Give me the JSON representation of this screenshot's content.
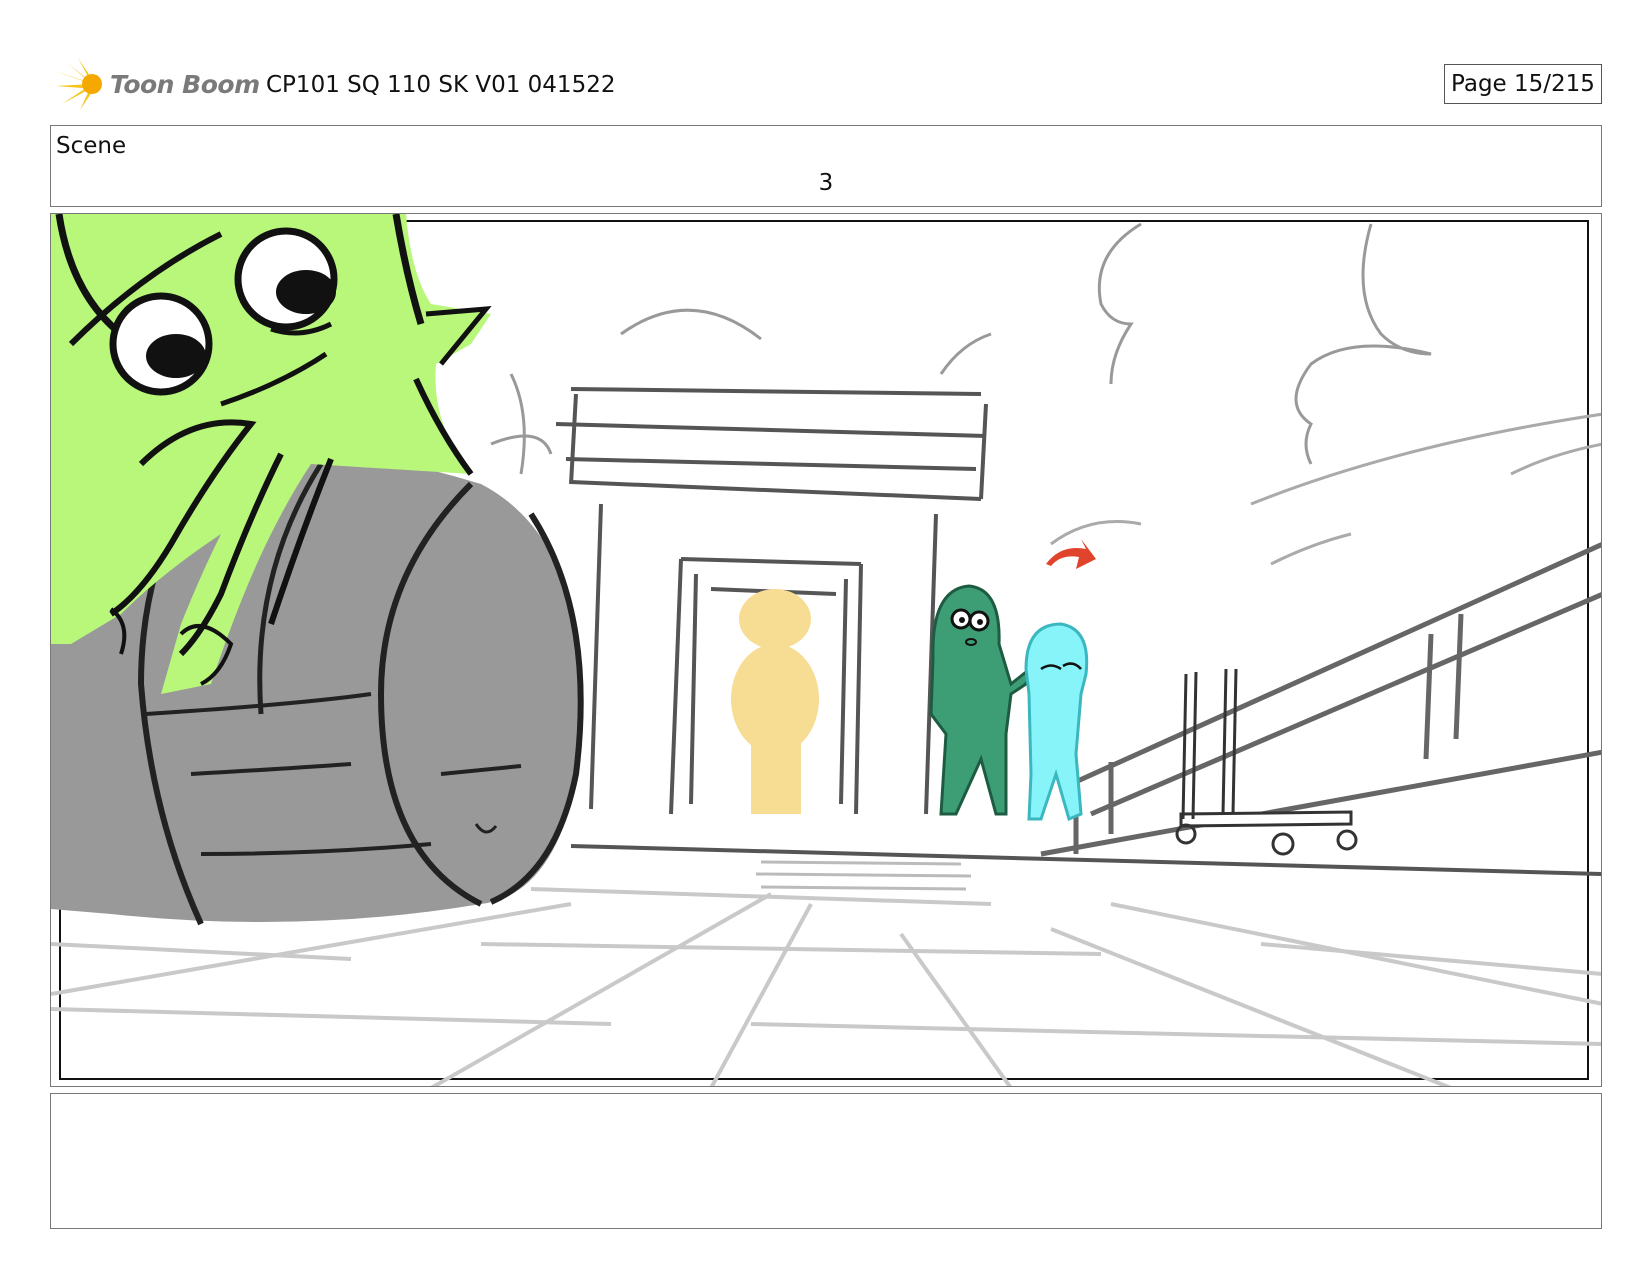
{
  "header": {
    "logo_text": "Toon Boom",
    "title": "CP101 SQ 110 SK V01 041522",
    "page_label": "Page  15/215"
  },
  "scene": {
    "label": "Scene",
    "number": "3"
  },
  "panel": {
    "colors": {
      "goblin": "#b8f77a",
      "barrel": "#999999",
      "yellow_figure": "#f7dc93",
      "green_figure": "#3d9e76",
      "cyan_figure": "#86f4f8",
      "arrow": "#e0442c"
    }
  },
  "notes": {
    "text": ""
  }
}
